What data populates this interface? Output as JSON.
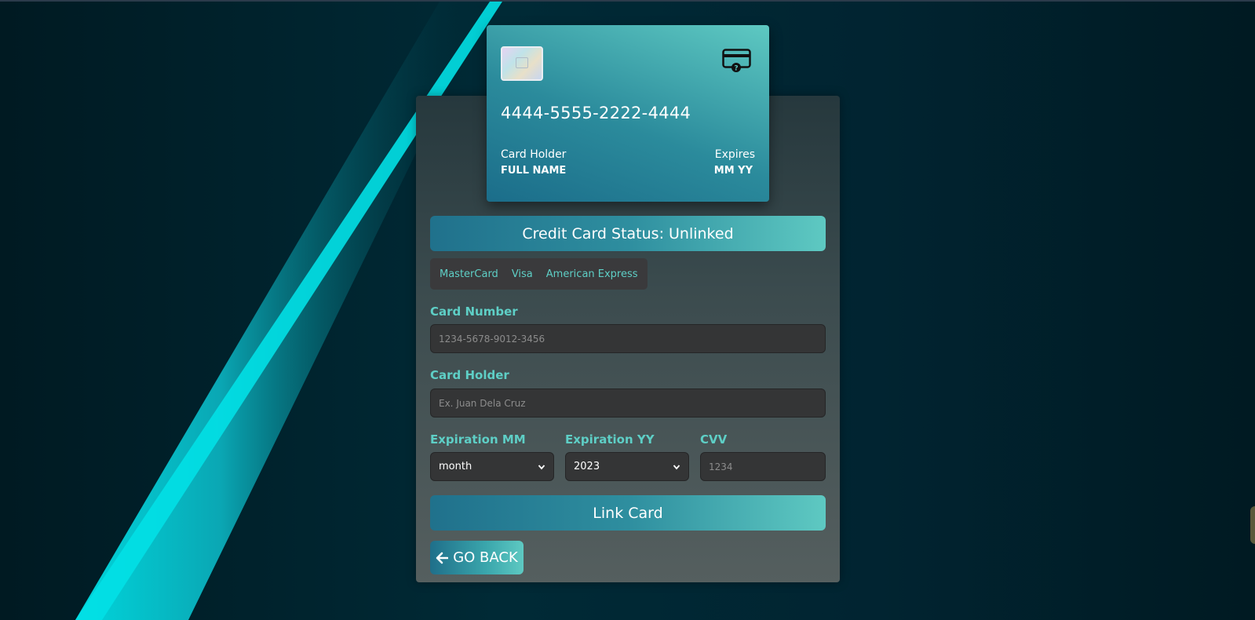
{
  "card": {
    "number": "4444-5555-2222-4444",
    "holder_label": "Card Holder",
    "holder_name": "FULL NAME",
    "expires_label": "Expires",
    "expires_value": "MM YY",
    "icon": "credit-card-question-icon"
  },
  "status": {
    "text": "Credit Card Status: Unlinked"
  },
  "brands": [
    "MasterCard",
    "Visa",
    "American Express"
  ],
  "form": {
    "card_number": {
      "label": "Card Number",
      "placeholder": "1234-5678-9012-3456"
    },
    "card_holder": {
      "label": "Card Holder",
      "placeholder": "Ex. Juan Dela Cruz"
    },
    "exp_mm": {
      "label": "Expiration MM",
      "value": "month"
    },
    "exp_yy": {
      "label": "Expiration YY",
      "value": "2023"
    },
    "cvv": {
      "label": "CVV",
      "placeholder": "1234"
    }
  },
  "buttons": {
    "link_card": "Link Card",
    "go_back": "GO BACK",
    "go_back_icon": "arrow-left-icon"
  },
  "colors": {
    "accent": "#5ecfc6",
    "gradient_start": "#20718c",
    "gradient_end": "#5ec9c2",
    "input_bg": "#343536"
  }
}
